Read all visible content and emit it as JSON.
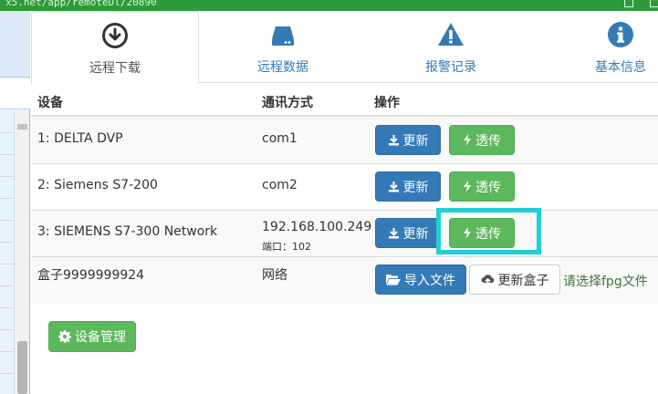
{
  "window": {
    "url_fragment": "x5.net/app/remoteDl/20890"
  },
  "tabs": [
    {
      "label": "远程下载",
      "icon": "download-circle-icon",
      "active": true
    },
    {
      "label": "远程数据",
      "icon": "hard-drive-icon",
      "active": false
    },
    {
      "label": "报警记录",
      "icon": "warning-icon",
      "active": false
    },
    {
      "label": "基本信息",
      "icon": "info-icon",
      "active": false
    }
  ],
  "table": {
    "headers": [
      "设备",
      "通讯方式",
      "操作"
    ],
    "rows": [
      {
        "device": "1: DELTA DVP",
        "comm": "com1",
        "port": "",
        "update_label": "更新",
        "passthrough_label": "透传"
      },
      {
        "device": "2: Siemens S7-200",
        "comm": "com2",
        "port": "",
        "update_label": "更新",
        "passthrough_label": "透传"
      },
      {
        "device": "3: SIEMENS S7-300 Network",
        "comm": "192.168.100.249",
        "port": "端口：102",
        "update_label": "更新",
        "passthrough_label": "透传"
      }
    ],
    "box_row": {
      "device": "盒子9999999924",
      "comm": "网络",
      "import_label": "导入文件",
      "update_box_label": "更新盒子",
      "hint": "请选择fpg文件"
    }
  },
  "device_management_label": "设备管理",
  "colors": {
    "primary": "#337ab7",
    "success": "#5cb85c",
    "highlight": "#1fd0d8",
    "titlebar": "#2e9b3a"
  }
}
